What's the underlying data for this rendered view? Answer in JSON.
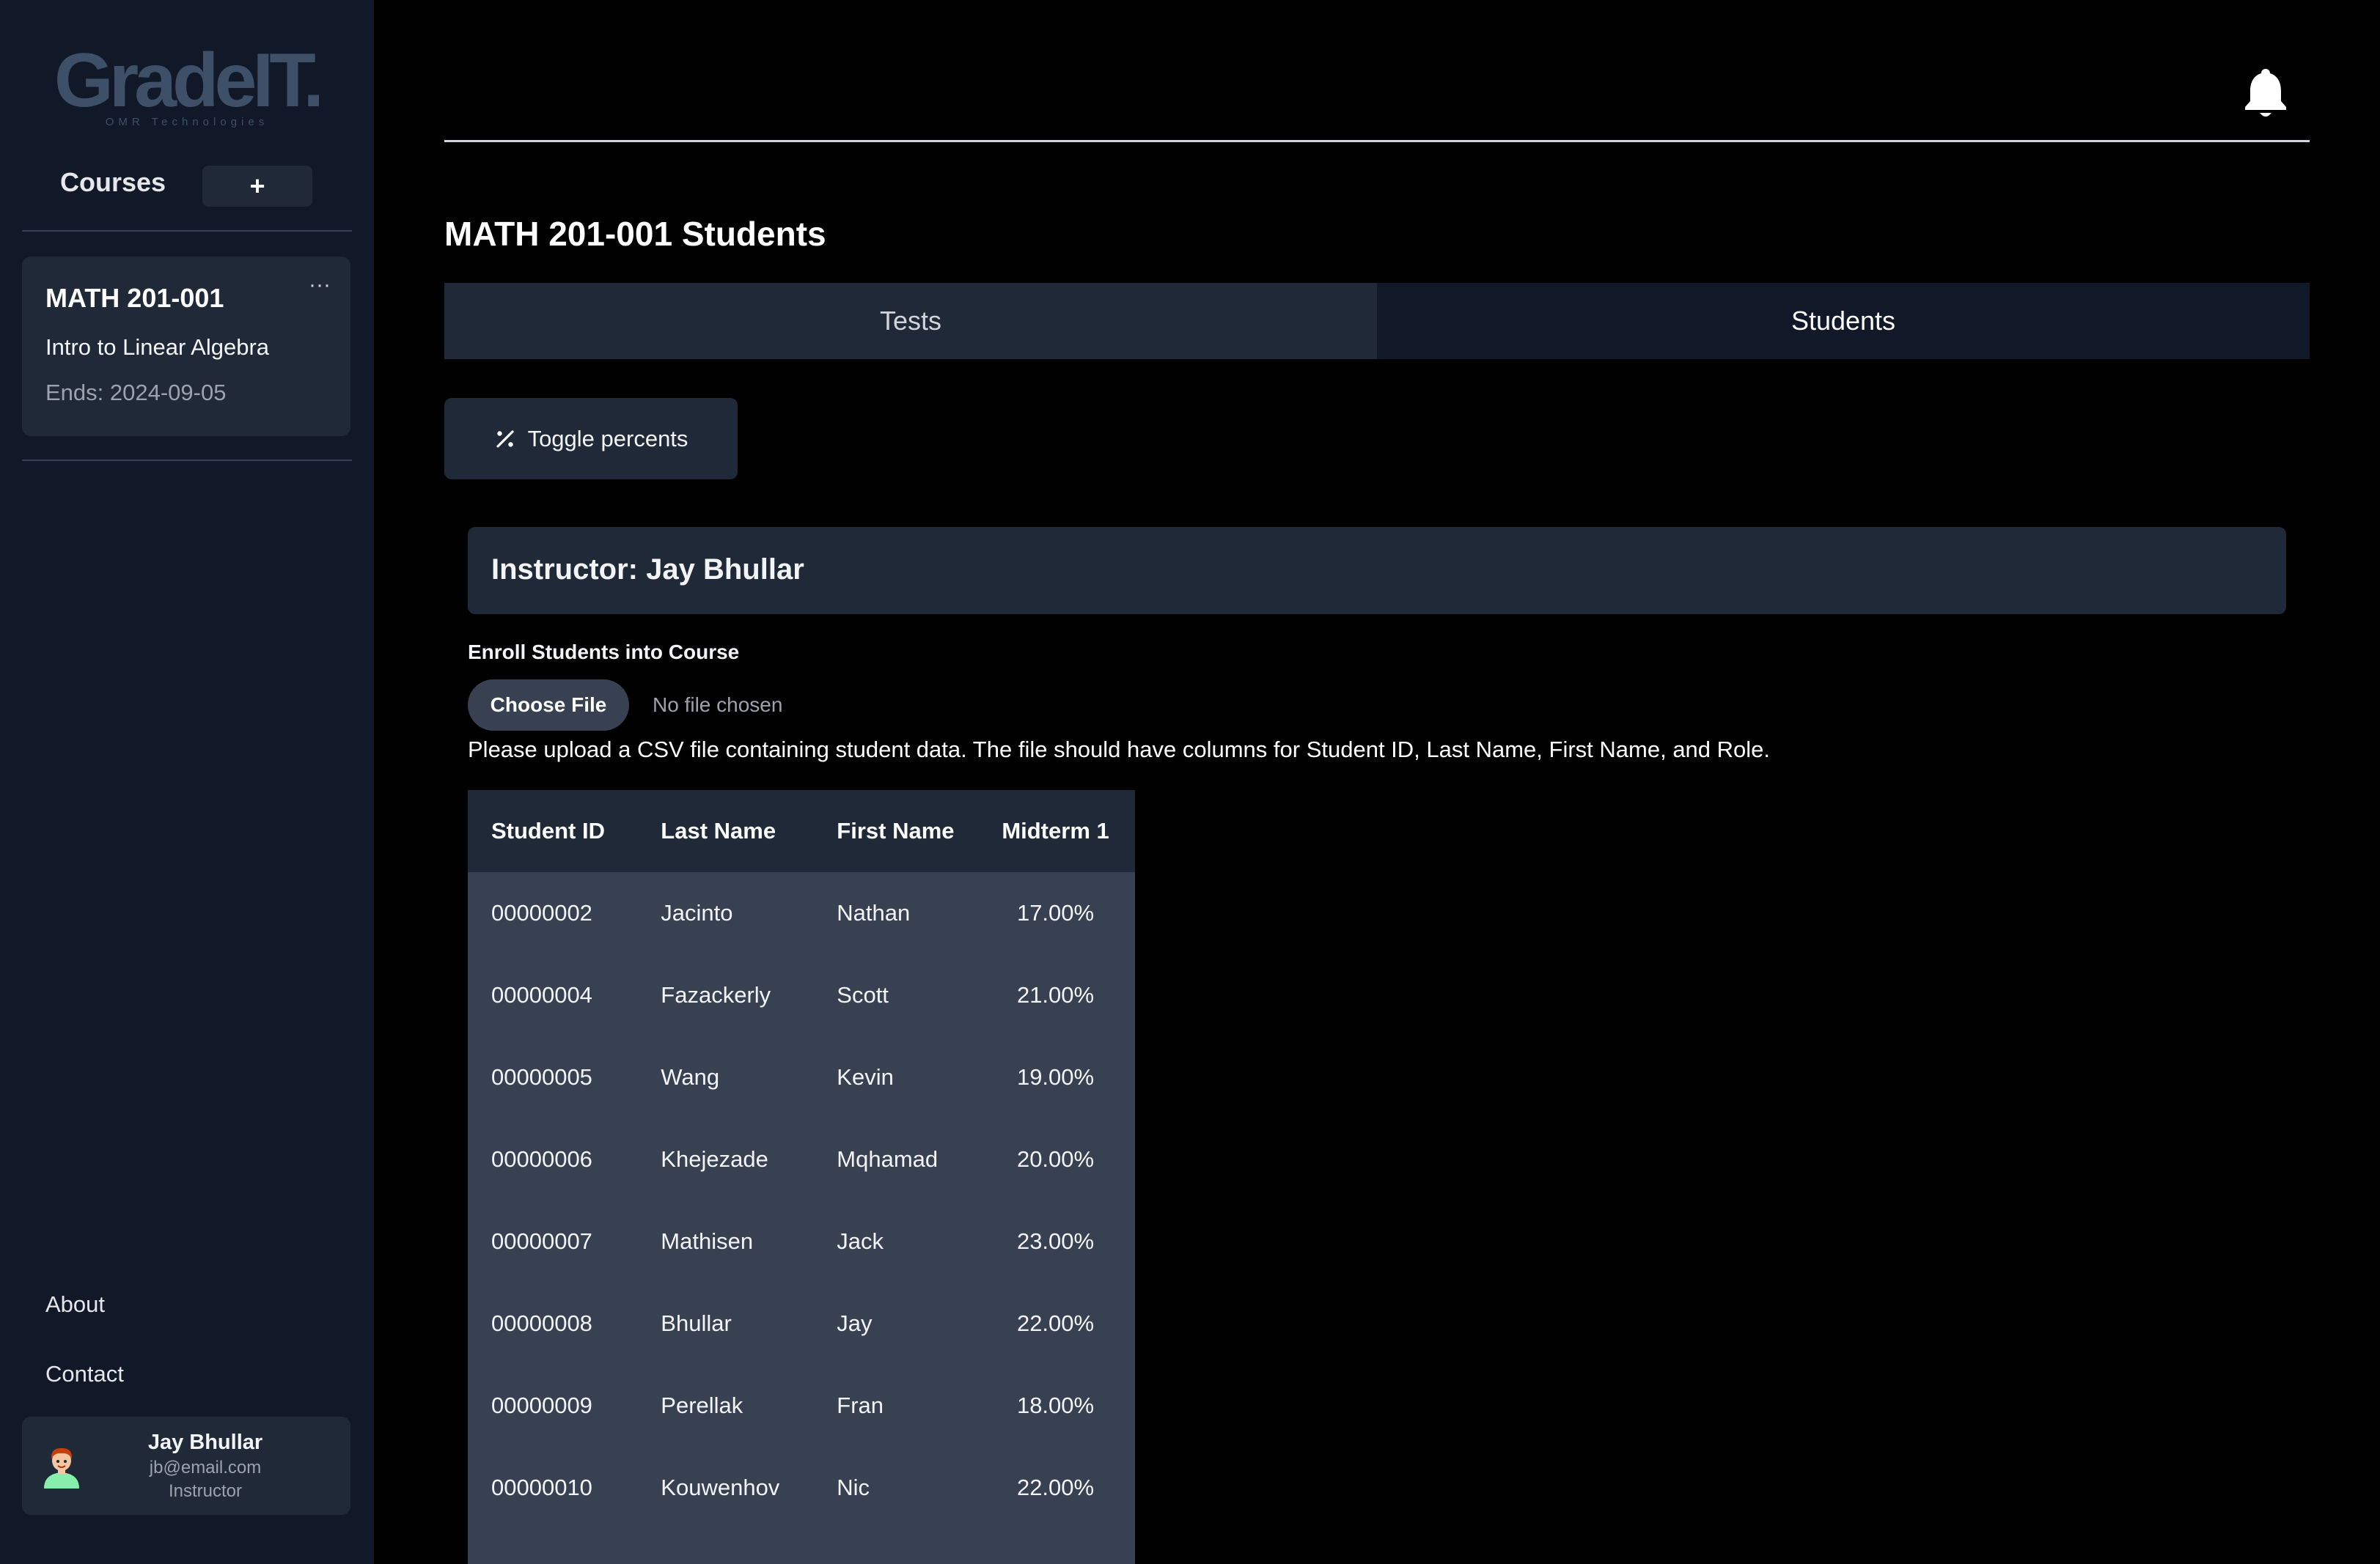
{
  "sidebar": {
    "logo": "GradeIT.",
    "logo_sub": "OMR Technologies",
    "courses_label": "Courses",
    "add_course_label": "+",
    "course": {
      "code": "MATH 201-001",
      "name": "Intro to Linear Algebra",
      "ends": "Ends: 2024-09-05",
      "menu": "···"
    },
    "links": {
      "about": "About",
      "contact": "Contact"
    },
    "user": {
      "name": "Jay Bhullar",
      "email": "jb@email.com",
      "role": "Instructor"
    }
  },
  "main": {
    "page_title": "MATH 201-001 Students",
    "tabs": [
      {
        "label": "Tests",
        "active": false
      },
      {
        "label": "Students",
        "active": true
      }
    ],
    "toggle_label": "Toggle percents",
    "instructor": "Instructor: Jay Bhullar",
    "enroll_label": "Enroll Students into Course",
    "choose_file_label": "Choose File",
    "no_file_label": "No file chosen",
    "upload_help": "Please upload a CSV file containing student data. The file should have columns for Student ID, Last Name, First Name, and Role.",
    "table": {
      "headers": [
        "Student ID",
        "Last Name",
        "First Name",
        "Midterm 1"
      ],
      "rows": [
        [
          "00000002",
          "Jacinto",
          "Nathan",
          "17.00%"
        ],
        [
          "00000004",
          "Fazackerly",
          "Scott",
          "21.00%"
        ],
        [
          "00000005",
          "Wang",
          "Kevin",
          "19.00%"
        ],
        [
          "00000006",
          "Khejezade",
          "Mqhamad",
          "20.00%"
        ],
        [
          "00000007",
          "Mathisen",
          "Jack",
          "23.00%"
        ],
        [
          "00000008",
          "Bhullar",
          "Jay",
          "22.00%"
        ],
        [
          "00000009",
          "Perellak",
          "Fran",
          "18.00%"
        ],
        [
          "00000010",
          "Kouwenhov",
          "Nic",
          "22.00%"
        ]
      ]
    }
  },
  "colors": {
    "sidebar_bg": "#111827",
    "card_bg": "#1f2937",
    "table_bg": "#374151",
    "page_bg": "#000000"
  }
}
